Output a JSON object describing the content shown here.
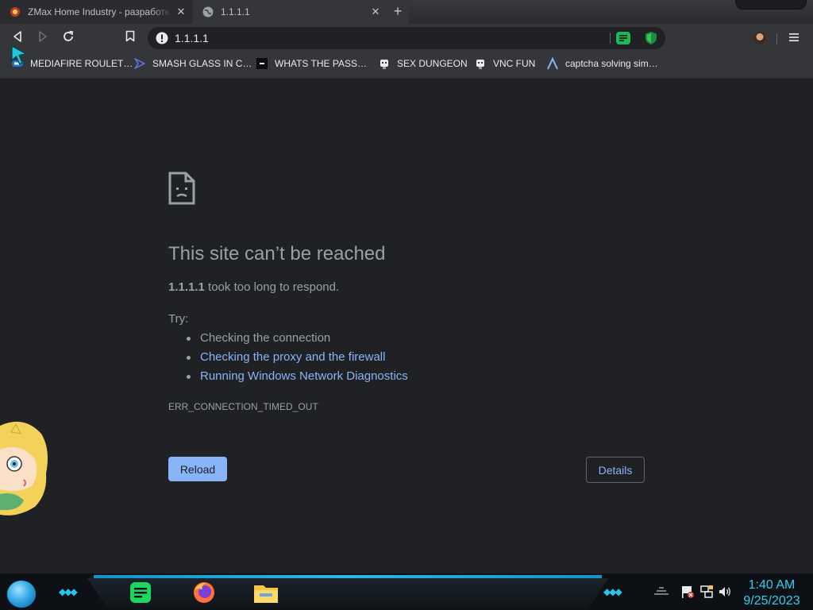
{
  "tabs": [
    {
      "title": "ZMax Home Industry - разработк…",
      "active": false,
      "favicon": "zmax-favicon"
    },
    {
      "title": "1.1.1.1",
      "active": true,
      "favicon": "globe-favicon"
    }
  ],
  "toolbar": {
    "url": "1.1.1.1",
    "security_icon": "not-secure-icon",
    "extensions": [
      "spotify-extension-icon",
      "shield-extension-icon"
    ]
  },
  "bookmarks": [
    {
      "label": "MEDIAFIRE ROULET…",
      "icon": "mediafire-icon"
    },
    {
      "label": "SMASH GLASS IN C…",
      "icon": "visual-studio-icon"
    },
    {
      "label": "WHATS THE PASS…",
      "icon": "terminal-icon"
    },
    {
      "label": "SEX DUNGEON",
      "icon": "robot-icon"
    },
    {
      "label": "VNC FUN",
      "icon": "robot-icon"
    },
    {
      "label": "captcha solving sim…",
      "icon": "lambda-icon"
    }
  ],
  "error_page": {
    "heading": "This site can’t be reached",
    "host": "1.1.1.1",
    "reason_suffix": "took too long to respond.",
    "try_label": "Try:",
    "suggestions": [
      {
        "text": "Checking the connection",
        "link": false
      },
      {
        "text": "Checking the proxy and the firewall",
        "link": true
      },
      {
        "text": "Running Windows Network Diagnostics",
        "link": true
      }
    ],
    "error_code": "ERR_CONNECTION_TIMED_OUT",
    "reload_label": "Reload",
    "details_label": "Details"
  },
  "taskbar": {
    "apps": [
      "spotify-taskbar-icon",
      "firefox-taskbar-icon",
      "file-explorer-taskbar-icon"
    ],
    "tray_icons": [
      "action-center-flag-icon",
      "network-icon",
      "volume-icon"
    ],
    "time": "1:40 AM",
    "date": "9/25/2023"
  },
  "colors": {
    "page_background": "#202124",
    "chrome_frame": "#35363a",
    "link": "#8ab4f8",
    "text": "#9aa0a6",
    "clock": "#30d0f0"
  }
}
